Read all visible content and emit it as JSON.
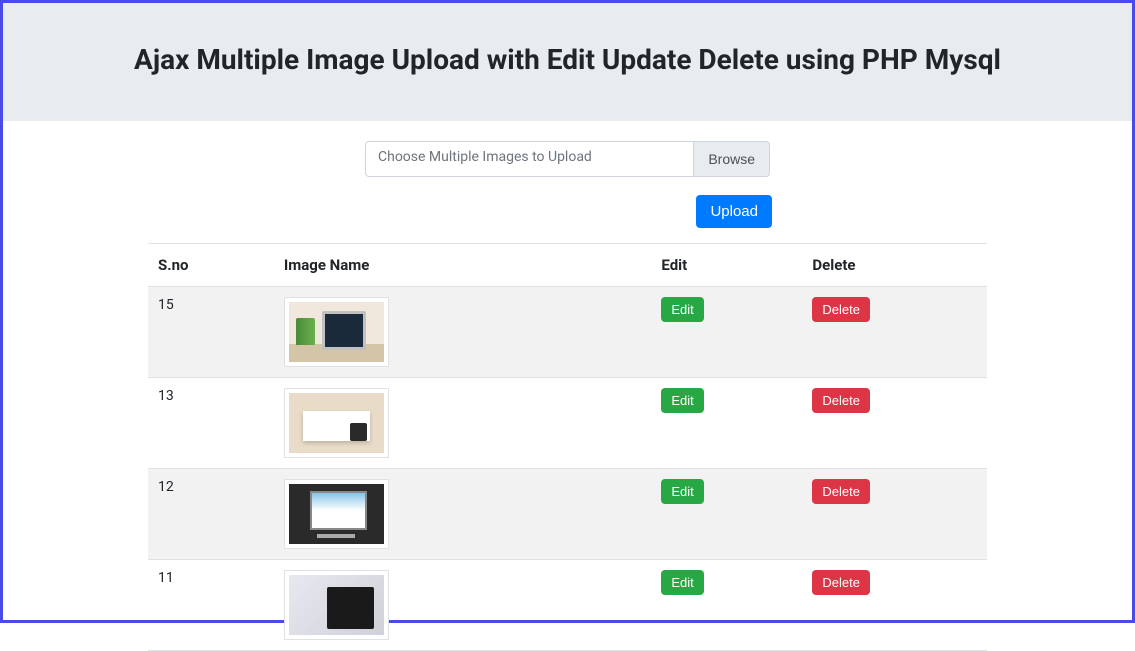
{
  "header": {
    "title": "Ajax Multiple Image Upload with Edit Update Delete using PHP Mysql"
  },
  "upload": {
    "placeholder": "Choose Multiple Images to Upload",
    "browse_label": "Browse",
    "submit_label": "Upload"
  },
  "table": {
    "columns": {
      "sno": "S.no",
      "image_name": "Image Name",
      "edit": "Edit",
      "delete": "Delete"
    },
    "edit_label": "Edit",
    "delete_label": "Delete",
    "rows": [
      {
        "sno": "15"
      },
      {
        "sno": "13"
      },
      {
        "sno": "12"
      },
      {
        "sno": "11"
      }
    ]
  }
}
